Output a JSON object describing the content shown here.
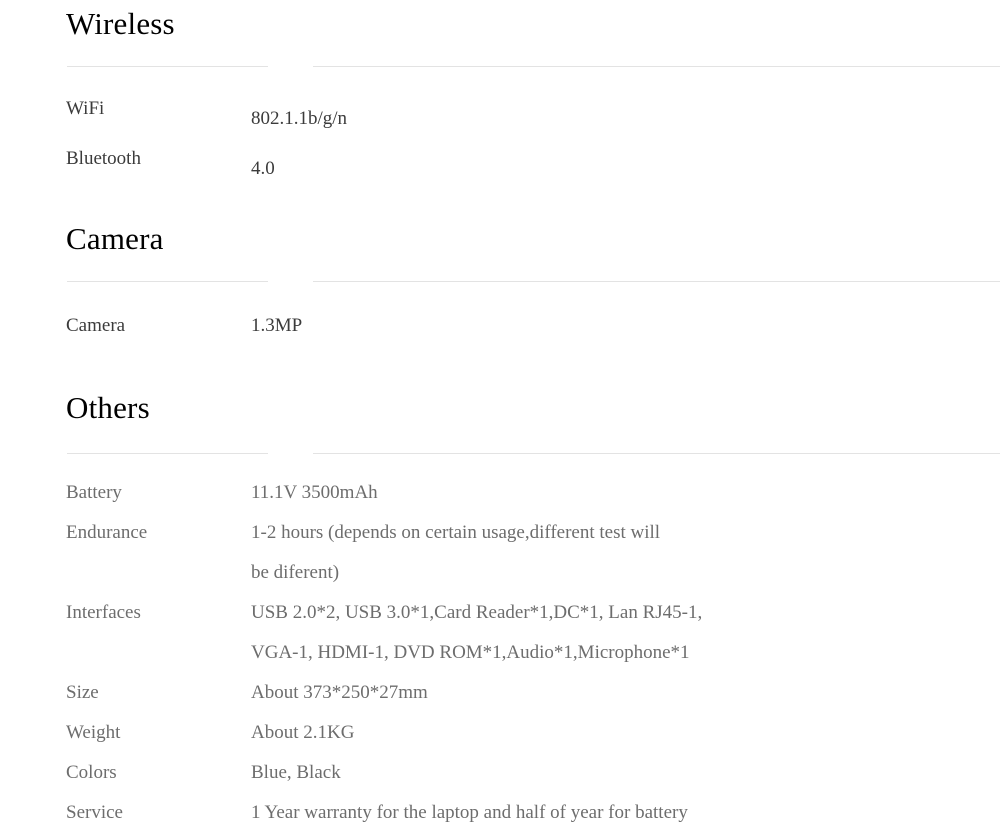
{
  "page": {
    "background_color": "#ffffff",
    "heading_color": "#000000",
    "rule_color": "#e3e3e3",
    "text_color_dark": "#3b3b3b",
    "text_color_light": "#6d6d6d"
  },
  "sections": [
    {
      "id": "wireless",
      "heading": "Wireless",
      "rows": [
        {
          "label": "WiFi",
          "value_lines": [
            "802.1.1b/g/n"
          ]
        },
        {
          "label": "Bluetooth",
          "value_lines": [
            "4.0"
          ]
        }
      ]
    },
    {
      "id": "camera",
      "heading": "Camera",
      "rows": [
        {
          "label": "Camera",
          "value_lines": [
            "1.3MP"
          ]
        }
      ]
    },
    {
      "id": "others",
      "heading": "Others",
      "rows": [
        {
          "label": "Battery",
          "value_lines": [
            "11.1V 3500mAh"
          ]
        },
        {
          "label": "Endurance",
          "value_lines": [
            "1-2 hours (depends on certain usage,different test will",
            "be diferent)"
          ]
        },
        {
          "label": "Interfaces",
          "value_lines": [
            "USB 2.0*2, USB 3.0*1,Card Reader*1,DC*1, Lan RJ45-1,",
            "VGA-1, HDMI-1, DVD ROM*1,Audio*1,Microphone*1"
          ]
        },
        {
          "label": "Size",
          "value_lines": [
            "About 373*250*27mm"
          ]
        },
        {
          "label": "Weight",
          "value_lines": [
            "About 2.1KG"
          ]
        },
        {
          "label": "Colors",
          "value_lines": [
            "Blue, Black"
          ]
        },
        {
          "label": "Service",
          "value_lines": [
            "1 Year warranty for the laptop and half of year for battery"
          ]
        }
      ]
    }
  ]
}
